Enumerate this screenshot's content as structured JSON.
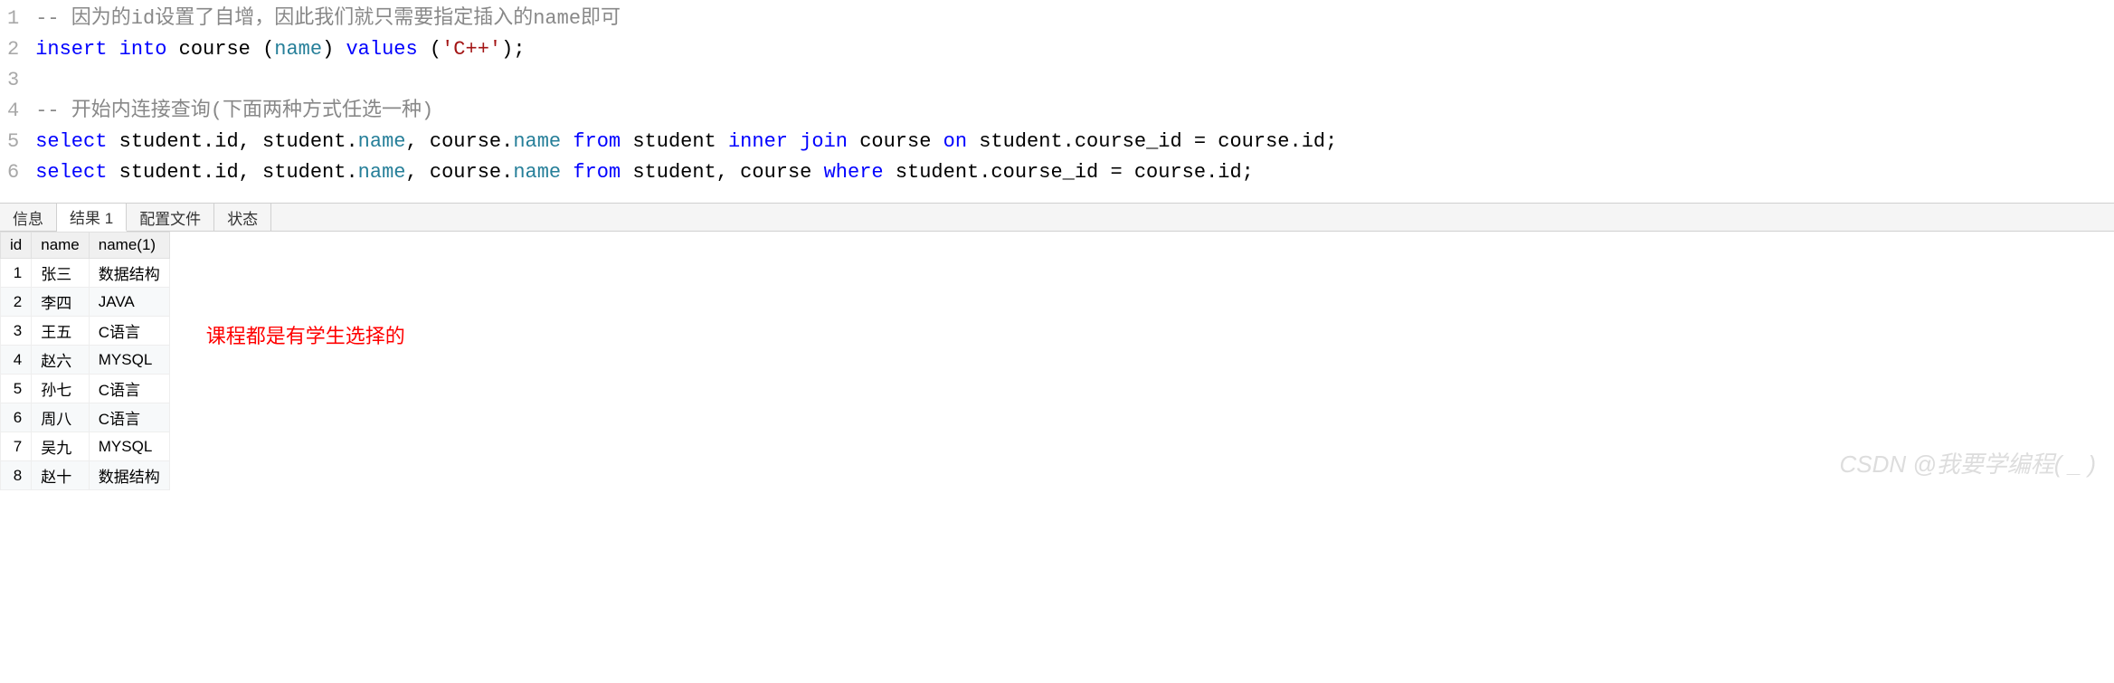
{
  "code": {
    "lines": [
      {
        "n": "1",
        "html": "<span class='tk-comment'>-- 因为的id设置了自增，因此我们就只需要指定插入的name即可</span>"
      },
      {
        "n": "2",
        "html": "<span class='tk-keyword'>insert</span> <span class='tk-keyword'>into</span> <span class='tk-ident'>course</span> <span class='tk-punct'>(</span><span class='tk-dot-ident'>name</span><span class='tk-punct'>)</span> <span class='tk-keyword'>values</span> <span class='tk-punct'>(</span><span class='tk-string'>'C++'</span><span class='tk-punct'>);</span>"
      },
      {
        "n": "3",
        "html": ""
      },
      {
        "n": "4",
        "html": "<span class='tk-comment'>-- 开始内连接查询(下面两种方式任选一种)</span>"
      },
      {
        "n": "5",
        "html": "<span class='tk-keyword'>select</span> <span class='tk-ident'>student.id, student.</span><span class='tk-dot-ident'>name</span><span class='tk-ident'>, course.</span><span class='tk-dot-ident'>name</span> <span class='tk-keyword'>from</span> <span class='tk-ident'>student</span> <span class='tk-keyword'>inner</span> <span class='tk-keyword'>join</span> <span class='tk-ident'>course</span> <span class='tk-keyword'>on</span> <span class='tk-ident'>student.course_id = course.id;</span>"
      },
      {
        "n": "6",
        "html": "<span class='tk-keyword'>select</span> <span class='tk-ident'>student.id, student.</span><span class='tk-dot-ident'>name</span><span class='tk-ident'>, course.</span><span class='tk-dot-ident'>name</span> <span class='tk-keyword'>from</span> <span class='tk-ident'>student, course</span> <span class='tk-keyword'>where</span> <span class='tk-ident'>student.course_id = course.id;</span>"
      }
    ]
  },
  "tabs": {
    "items": [
      {
        "label": "信息",
        "active": false
      },
      {
        "label": "结果 1",
        "active": true
      },
      {
        "label": "配置文件",
        "active": false
      },
      {
        "label": "状态",
        "active": false
      }
    ]
  },
  "result": {
    "columns": [
      "id",
      "name",
      "name(1)"
    ],
    "rows": [
      {
        "id": "1",
        "name": "张三",
        "name1": "数据结构"
      },
      {
        "id": "2",
        "name": "李四",
        "name1": "JAVA"
      },
      {
        "id": "3",
        "name": "王五",
        "name1": "C语言"
      },
      {
        "id": "4",
        "name": "赵六",
        "name1": "MYSQL"
      },
      {
        "id": "5",
        "name": "孙七",
        "name1": "C语言"
      },
      {
        "id": "6",
        "name": "周八",
        "name1": "C语言"
      },
      {
        "id": "7",
        "name": "吴九",
        "name1": "MYSQL"
      },
      {
        "id": "8",
        "name": "赵十",
        "name1": "数据结构"
      }
    ]
  },
  "annotation": "课程都是有学生选择的",
  "watermark": "CSDN @我要学编程( _ )"
}
